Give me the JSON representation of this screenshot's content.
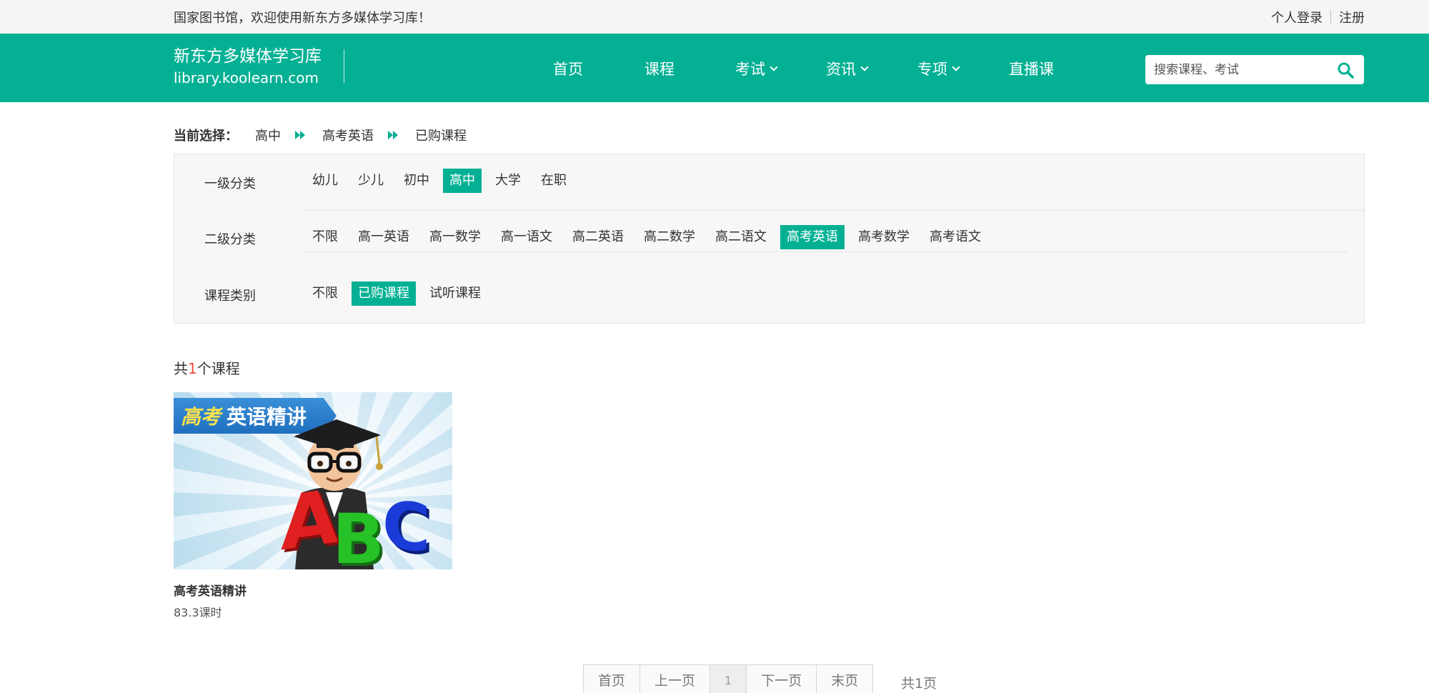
{
  "topbar": {
    "welcome": "国家图书馆，欢迎使用新东方多媒体学习库！",
    "login": "个人登录",
    "register": "注册"
  },
  "brand": {
    "name": "新东方多媒体学习库",
    "domain": "library.koolearn.com"
  },
  "nav": {
    "items": [
      {
        "label": "首页",
        "dropdown": false
      },
      {
        "label": "课程",
        "dropdown": false
      },
      {
        "label": "考试",
        "dropdown": true
      },
      {
        "label": "资讯",
        "dropdown": true
      },
      {
        "label": "专项",
        "dropdown": true
      },
      {
        "label": "直播课",
        "dropdown": false
      }
    ]
  },
  "search": {
    "placeholder": "搜索课程、考试",
    "icon": "search-icon"
  },
  "breadcrumb": {
    "label": "当前选择：",
    "items": [
      "高中",
      "高考英语",
      "已购课程"
    ]
  },
  "filters": {
    "level1": {
      "label": "一级分类",
      "options": [
        "幼儿",
        "少儿",
        "初中",
        "高中",
        "大学",
        "在职"
      ],
      "selected": "高中"
    },
    "level2": {
      "label": "二级分类",
      "options": [
        "不限",
        "高一英语",
        "高一数学",
        "高一语文",
        "高二英语",
        "高二数学",
        "高二语文",
        "高考英语",
        "高考数学",
        "高考语文"
      ],
      "selected": "高考英语"
    },
    "type": {
      "label": "课程类别",
      "options": [
        "不限",
        "已购课程",
        "试听课程"
      ],
      "selected": "已购课程"
    }
  },
  "results": {
    "prefix": "共",
    "count": "1",
    "suffix": "个课程"
  },
  "courses": [
    {
      "title": "高考英语精讲",
      "hours": "83.3课时",
      "thumb_banner_a": "高考",
      "thumb_banner_b": "英语精讲",
      "thumb_letters": [
        "A",
        "B",
        "C"
      ]
    }
  ],
  "pagination": {
    "first": "首页",
    "prev": "上一页",
    "current": "1",
    "next": "下一页",
    "last": "末页",
    "total": "共1页"
  },
  "colors": {
    "brand": "#04b094",
    "accent_number": "#e54b3c"
  }
}
